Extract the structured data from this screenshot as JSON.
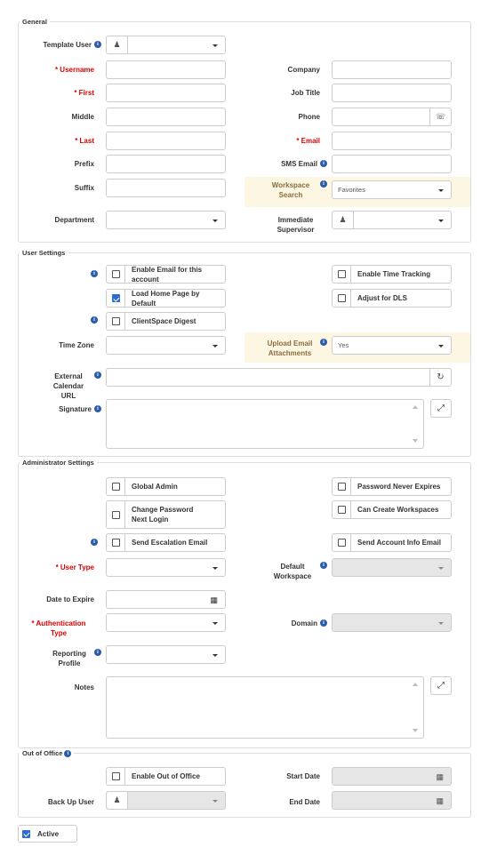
{
  "general": {
    "legend": "General",
    "template_user": "Template User",
    "username": "* Username",
    "first": "* First",
    "middle": "Middle",
    "last": "* Last",
    "prefix": "Prefix",
    "suffix": "Suffix",
    "department": "Department",
    "company": "Company",
    "job_title": "Job Title",
    "phone": "Phone",
    "email": "* Email",
    "sms_email": "SMS Email",
    "workspace_search": "Workspace Search",
    "workspace_search_value": "Favorites",
    "immediate_supervisor": "Immediate Supervisor"
  },
  "user_settings": {
    "legend": "User Settings",
    "enable_email": "Enable Email for this account",
    "enable_time_tracking": "Enable Time Tracking",
    "load_home_page": "Load Home Page by Default",
    "adjust_dls": "Adjust for DLS",
    "clientspace_digest": "ClientSpace Digest",
    "time_zone": "Time Zone",
    "upload_email_attachments": "Upload Email Attachments",
    "upload_email_value": "Yes",
    "external_calendar_url": "External Calendar URL",
    "signature": "Signature"
  },
  "admin_settings": {
    "legend": "Administrator Settings",
    "global_admin": "Global Admin",
    "password_never_expires": "Password Never Expires",
    "change_password": "Change Password Next Login",
    "can_create_workspaces": "Can Create Workspaces",
    "send_escalation_email": "Send Escalation Email",
    "send_account_info_email": "Send Account Info Email",
    "user_type": "* User Type",
    "default_workspace": "Default Workspace",
    "date_to_expire": "Date to Expire",
    "authentication_type": "* Authentication Type",
    "domain": "Domain",
    "reporting_profile": "Reporting Profile",
    "notes": "Notes"
  },
  "out_of_office": {
    "legend": "Out of Office",
    "enable_out_of_office": "Enable Out of Office",
    "start_date": "Start Date",
    "back_up_user": "Back Up User",
    "end_date": "End Date"
  },
  "active": "Active",
  "icons": {
    "info": "info-icon",
    "person": "person-icon",
    "phone": "phone-icon",
    "calendar": "calendar-icon",
    "refresh": "refresh-icon",
    "expand": "expand-icon"
  },
  "colors": {
    "required": "#dd0000",
    "info": "#2a5da8",
    "highlight": "#fdf6e3",
    "checked": "#2a6fd0"
  }
}
